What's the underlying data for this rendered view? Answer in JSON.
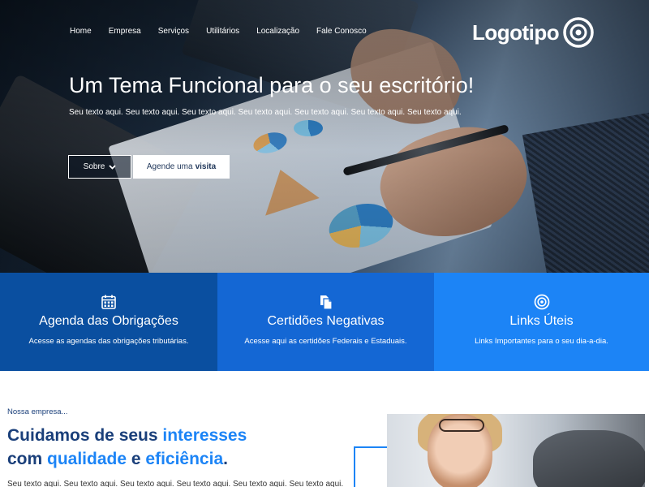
{
  "nav": {
    "items": [
      "Home",
      "Empresa",
      "Serviços",
      "Utilitários",
      "Localização",
      "Fale Conosco"
    ]
  },
  "logo": {
    "text": "Logotipo",
    "icon": "target-icon"
  },
  "hero": {
    "title": "Um Tema Funcional para o seu escritório!",
    "subtitle": "Seu texto aqui. Seu texto aqui. Seu texto aqui. Seu texto aqui. Seu texto aqui. Seu texto aqui. Seu texto aqui.",
    "btn_sobre": "Sobre",
    "btn_agende_prefix": "Agende uma",
    "btn_agende_bold": "visita"
  },
  "features": [
    {
      "icon": "calendar-icon",
      "title": "Agenda das Obrigações",
      "desc": "Acesse as agendas das obrigações tributárias.",
      "color": "#0a4fa0"
    },
    {
      "icon": "documents-icon",
      "title": "Certidões Negativas",
      "desc": "Acesse aqui as certidões Federais e Estaduais.",
      "color": "#1467d4"
    },
    {
      "icon": "target-icon",
      "title": "Links Úteis",
      "desc": "Links Importantes para o seu dia-a-dia.",
      "color": "#1c84f6"
    }
  ],
  "about": {
    "kicker": "Nossa empresa...",
    "title_1": "Cuidamos de seus ",
    "title_hl1": "interesses",
    "title_2": "com ",
    "title_hl2": "qualidade",
    "title_3": " e ",
    "title_hl3": "eficiência",
    "title_4": ".",
    "text": "Seu texto aqui. Seu texto aqui. Seu texto aqui. Seu texto aqui. Seu texto aqui. Seu texto aqui."
  },
  "colors": {
    "primary_dark": "#0a4fa0",
    "primary": "#1467d4",
    "accent": "#1c84f6",
    "heading": "#1a3f7a"
  }
}
